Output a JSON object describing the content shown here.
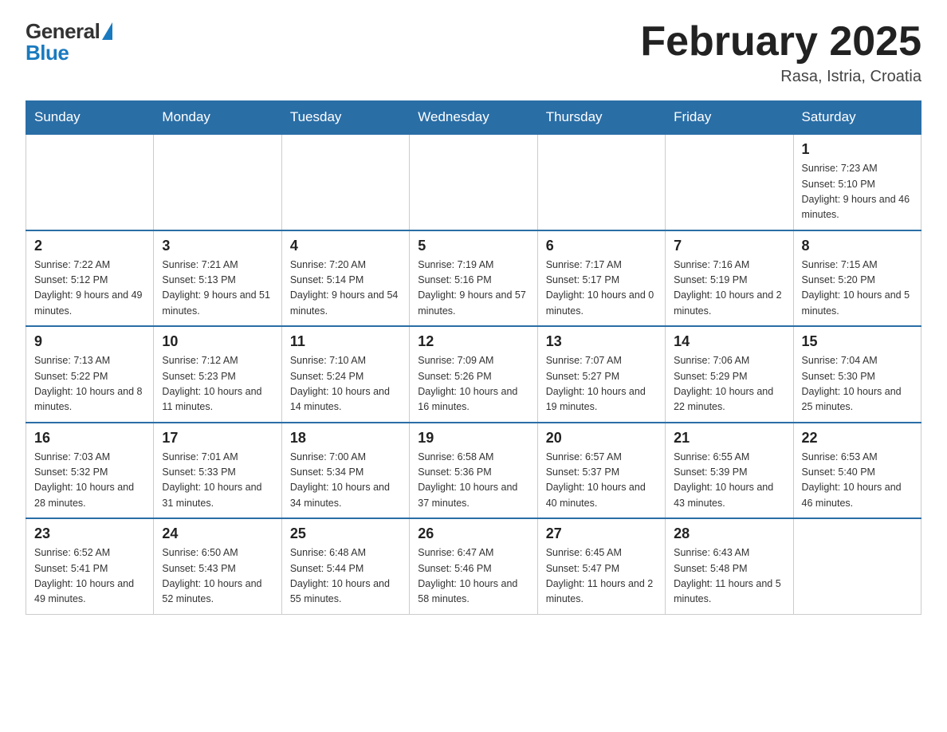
{
  "logo": {
    "general": "General",
    "blue": "Blue"
  },
  "header": {
    "month_year": "February 2025",
    "location": "Rasa, Istria, Croatia"
  },
  "weekdays": [
    "Sunday",
    "Monday",
    "Tuesday",
    "Wednesday",
    "Thursday",
    "Friday",
    "Saturday"
  ],
  "weeks": [
    [
      {
        "day": "",
        "info": ""
      },
      {
        "day": "",
        "info": ""
      },
      {
        "day": "",
        "info": ""
      },
      {
        "day": "",
        "info": ""
      },
      {
        "day": "",
        "info": ""
      },
      {
        "day": "",
        "info": ""
      },
      {
        "day": "1",
        "info": "Sunrise: 7:23 AM\nSunset: 5:10 PM\nDaylight: 9 hours and 46 minutes."
      }
    ],
    [
      {
        "day": "2",
        "info": "Sunrise: 7:22 AM\nSunset: 5:12 PM\nDaylight: 9 hours and 49 minutes."
      },
      {
        "day": "3",
        "info": "Sunrise: 7:21 AM\nSunset: 5:13 PM\nDaylight: 9 hours and 51 minutes."
      },
      {
        "day": "4",
        "info": "Sunrise: 7:20 AM\nSunset: 5:14 PM\nDaylight: 9 hours and 54 minutes."
      },
      {
        "day": "5",
        "info": "Sunrise: 7:19 AM\nSunset: 5:16 PM\nDaylight: 9 hours and 57 minutes."
      },
      {
        "day": "6",
        "info": "Sunrise: 7:17 AM\nSunset: 5:17 PM\nDaylight: 10 hours and 0 minutes."
      },
      {
        "day": "7",
        "info": "Sunrise: 7:16 AM\nSunset: 5:19 PM\nDaylight: 10 hours and 2 minutes."
      },
      {
        "day": "8",
        "info": "Sunrise: 7:15 AM\nSunset: 5:20 PM\nDaylight: 10 hours and 5 minutes."
      }
    ],
    [
      {
        "day": "9",
        "info": "Sunrise: 7:13 AM\nSunset: 5:22 PM\nDaylight: 10 hours and 8 minutes."
      },
      {
        "day": "10",
        "info": "Sunrise: 7:12 AM\nSunset: 5:23 PM\nDaylight: 10 hours and 11 minutes."
      },
      {
        "day": "11",
        "info": "Sunrise: 7:10 AM\nSunset: 5:24 PM\nDaylight: 10 hours and 14 minutes."
      },
      {
        "day": "12",
        "info": "Sunrise: 7:09 AM\nSunset: 5:26 PM\nDaylight: 10 hours and 16 minutes."
      },
      {
        "day": "13",
        "info": "Sunrise: 7:07 AM\nSunset: 5:27 PM\nDaylight: 10 hours and 19 minutes."
      },
      {
        "day": "14",
        "info": "Sunrise: 7:06 AM\nSunset: 5:29 PM\nDaylight: 10 hours and 22 minutes."
      },
      {
        "day": "15",
        "info": "Sunrise: 7:04 AM\nSunset: 5:30 PM\nDaylight: 10 hours and 25 minutes."
      }
    ],
    [
      {
        "day": "16",
        "info": "Sunrise: 7:03 AM\nSunset: 5:32 PM\nDaylight: 10 hours and 28 minutes."
      },
      {
        "day": "17",
        "info": "Sunrise: 7:01 AM\nSunset: 5:33 PM\nDaylight: 10 hours and 31 minutes."
      },
      {
        "day": "18",
        "info": "Sunrise: 7:00 AM\nSunset: 5:34 PM\nDaylight: 10 hours and 34 minutes."
      },
      {
        "day": "19",
        "info": "Sunrise: 6:58 AM\nSunset: 5:36 PM\nDaylight: 10 hours and 37 minutes."
      },
      {
        "day": "20",
        "info": "Sunrise: 6:57 AM\nSunset: 5:37 PM\nDaylight: 10 hours and 40 minutes."
      },
      {
        "day": "21",
        "info": "Sunrise: 6:55 AM\nSunset: 5:39 PM\nDaylight: 10 hours and 43 minutes."
      },
      {
        "day": "22",
        "info": "Sunrise: 6:53 AM\nSunset: 5:40 PM\nDaylight: 10 hours and 46 minutes."
      }
    ],
    [
      {
        "day": "23",
        "info": "Sunrise: 6:52 AM\nSunset: 5:41 PM\nDaylight: 10 hours and 49 minutes."
      },
      {
        "day": "24",
        "info": "Sunrise: 6:50 AM\nSunset: 5:43 PM\nDaylight: 10 hours and 52 minutes."
      },
      {
        "day": "25",
        "info": "Sunrise: 6:48 AM\nSunset: 5:44 PM\nDaylight: 10 hours and 55 minutes."
      },
      {
        "day": "26",
        "info": "Sunrise: 6:47 AM\nSunset: 5:46 PM\nDaylight: 10 hours and 58 minutes."
      },
      {
        "day": "27",
        "info": "Sunrise: 6:45 AM\nSunset: 5:47 PM\nDaylight: 11 hours and 2 minutes."
      },
      {
        "day": "28",
        "info": "Sunrise: 6:43 AM\nSunset: 5:48 PM\nDaylight: 11 hours and 5 minutes."
      },
      {
        "day": "",
        "info": ""
      }
    ]
  ]
}
